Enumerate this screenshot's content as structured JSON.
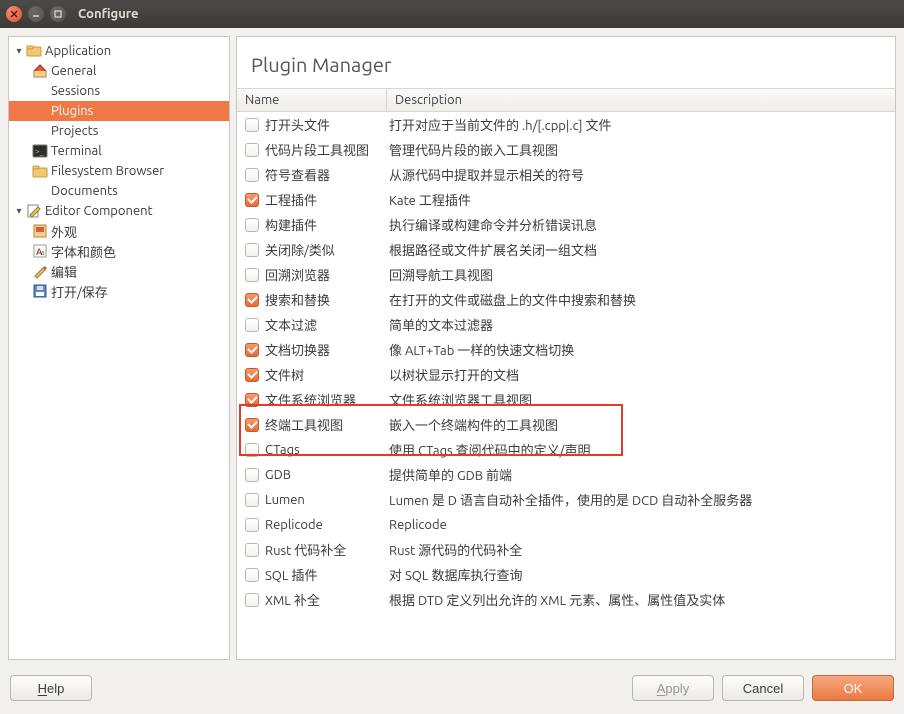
{
  "window": {
    "title": "Configure"
  },
  "sidebar": {
    "application": {
      "label": "Application",
      "general": "General",
      "sessions": "Sessions",
      "plugins": "Plugins",
      "projects": "Projects",
      "terminal": "Terminal",
      "fsbrowser": "Filesystem Browser",
      "documents": "Documents"
    },
    "editor": {
      "label": "Editor Component",
      "appearance": "外观",
      "fonts": "字体和颜色",
      "edit": "编辑",
      "opensave": "打开/保存"
    }
  },
  "main": {
    "title": "Plugin Manager",
    "col_name": "Name",
    "col_desc": "Description"
  },
  "plugins": [
    {
      "checked": false,
      "name": "打开头文件",
      "desc": "打开对应于当前文件的 .h/[.cpp|.c] 文件"
    },
    {
      "checked": false,
      "name": "代码片段工具视图",
      "desc": "管理代码片段的嵌入工具视图"
    },
    {
      "checked": false,
      "name": "符号查看器",
      "desc": "从源代码中提取并显示相关的符号"
    },
    {
      "checked": true,
      "name": "工程插件",
      "desc": "Kate 工程插件"
    },
    {
      "checked": false,
      "name": "构建插件",
      "desc": "执行编译或构建命令并分析错误讯息"
    },
    {
      "checked": false,
      "name": "关闭除/类似",
      "desc": "根据路径或文件扩展名关闭一组文档"
    },
    {
      "checked": false,
      "name": "回溯浏览器",
      "desc": "回溯导航工具视图"
    },
    {
      "checked": true,
      "name": "搜索和替换",
      "desc": "在打开的文件或磁盘上的文件中搜索和替换"
    },
    {
      "checked": false,
      "name": "文本过滤",
      "desc": "简单的文本过滤器"
    },
    {
      "checked": true,
      "name": "文档切换器",
      "desc": "像 ALT+Tab 一样的快速文档切换"
    },
    {
      "checked": true,
      "name": "文件树",
      "desc": "以树状显示打开的文档"
    },
    {
      "checked": true,
      "name": "文件系统浏览器",
      "desc": "文件系统浏览器工具视图"
    },
    {
      "checked": true,
      "name": "终端工具视图",
      "desc": "嵌入一个终端构件的工具视图"
    },
    {
      "checked": false,
      "name": "CTags",
      "desc": "使用 CTags 查阅代码中的定义/声明"
    },
    {
      "checked": false,
      "name": "GDB",
      "desc": "提供简单的 GDB 前端"
    },
    {
      "checked": false,
      "name": "Lumen",
      "desc": "Lumen 是 D 语言自动补全插件，使用的是 DCD 自动补全服务器"
    },
    {
      "checked": false,
      "name": "Replicode",
      "desc": "Replicode"
    },
    {
      "checked": false,
      "name": "Rust 代码补全",
      "desc": "Rust 源代码的代码补全"
    },
    {
      "checked": false,
      "name": "SQL 插件",
      "desc": "对 SQL 数据库执行查询"
    },
    {
      "checked": false,
      "name": "XML 补全",
      "desc": "根据 DTD 定义列出允许的 XML 元素、属性、属性值及实体"
    }
  ],
  "footer": {
    "help": "Help",
    "apply": "Apply",
    "cancel": "Cancel",
    "ok": "OK"
  }
}
